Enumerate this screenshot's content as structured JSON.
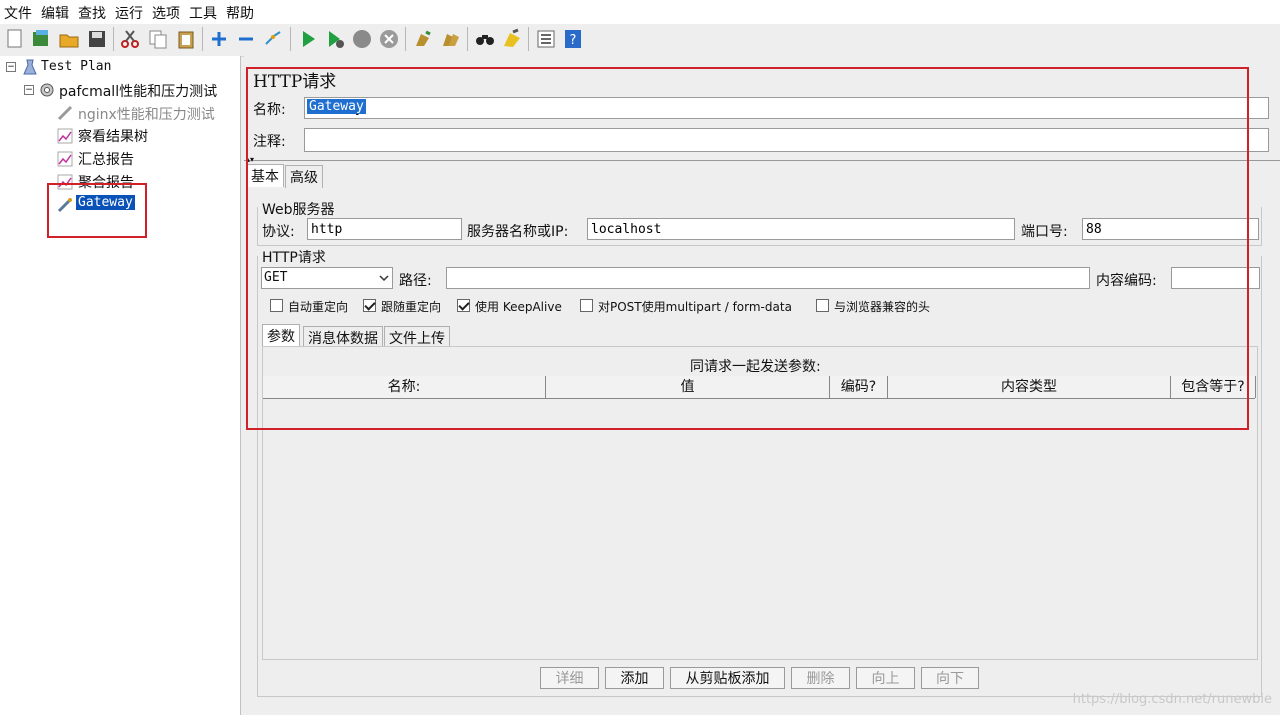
{
  "menu": [
    "文件",
    "编辑",
    "查找",
    "运行",
    "选项",
    "工具",
    "帮助"
  ],
  "toolbar_icons": [
    "new-icon",
    "templates-icon",
    "open-icon",
    "save-icon",
    "cut-icon",
    "copy-icon",
    "paste-icon",
    "expand-icon",
    "collapse-icon",
    "toggle-icon",
    "start-icon",
    "start-no-pause-icon",
    "stop-icon",
    "shutdown-icon",
    "clear-icon",
    "clear-all-icon",
    "search-icon",
    "reset-search-icon",
    "function-helper-icon",
    "help-icon"
  ],
  "tree": {
    "root": "Test Plan",
    "thread_group": "pafcmall性能和压力测试",
    "items": [
      "nginx性能和压力测试",
      "察看结果树",
      "汇总报告",
      "聚合报告",
      "Gateway"
    ]
  },
  "panel": {
    "title": "HTTP请求",
    "name_label": "名称:",
    "name_value": "Gateway",
    "comment_label": "注释:",
    "comment_value": "",
    "tabs": [
      "基本",
      "高级"
    ],
    "web_server": {
      "section": "Web服务器",
      "protocol_label": "协议:",
      "protocol_value": "http",
      "server_label": "服务器名称或IP:",
      "server_value": "localhost",
      "port_label": "端口号:",
      "port_value": "88"
    },
    "http_request": {
      "section": "HTTP请求",
      "method": "GET",
      "path_label": "路径:",
      "path_value": "",
      "encoding_label": "内容编码:",
      "encoding_value": ""
    },
    "options": [
      {
        "label": "自动重定向",
        "checked": false
      },
      {
        "label": "跟随重定向",
        "checked": true
      },
      {
        "label": "使用 KeepAlive",
        "checked": true
      },
      {
        "label": "对POST使用multipart / form-data",
        "checked": false
      },
      {
        "label": "与浏览器兼容的头",
        "checked": false
      }
    ],
    "sub_tabs": [
      "参数",
      "消息体数据",
      "文件上传"
    ],
    "params_caption": "同请求一起发送参数:",
    "columns": [
      "名称:",
      "值",
      "编码?",
      "内容类型",
      "包含等于?"
    ],
    "buttons": [
      {
        "label": "详细",
        "enabled": false
      },
      {
        "label": "添加",
        "enabled": true
      },
      {
        "label": "从剪贴板添加",
        "enabled": true
      },
      {
        "label": "删除",
        "enabled": false
      },
      {
        "label": "向上",
        "enabled": false
      },
      {
        "label": "向下",
        "enabled": false
      }
    ]
  },
  "watermark": "https://blog.csdn.net/runewbie"
}
